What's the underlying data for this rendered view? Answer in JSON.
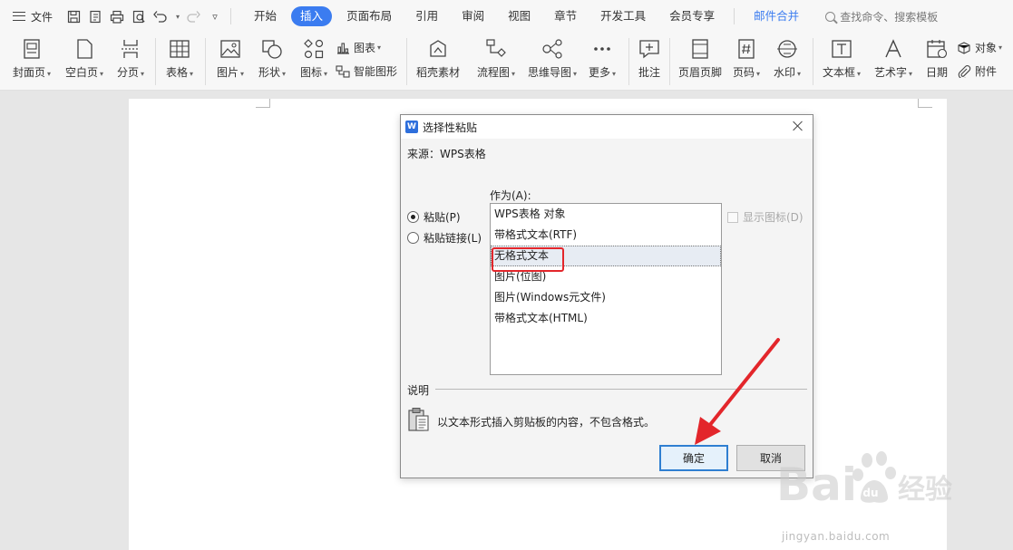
{
  "menubar": {
    "file_label": "文件",
    "tabs": [
      "开始",
      "插入",
      "页面布局",
      "引用",
      "审阅",
      "视图",
      "章节",
      "开发工具",
      "会员专享"
    ],
    "active_tab": "插入",
    "accent_tab": "邮件合并",
    "search_label": "查找命令、搜索模板"
  },
  "ribbon": {
    "cover_page": "封面页",
    "blank_page": "空白页",
    "page_break": "分页",
    "table": "表格",
    "picture": "图片",
    "shape": "形状",
    "icon": "图标",
    "chart": "图表",
    "smart_art": "智能图形",
    "shell_material": "稻壳素材",
    "flowchart": "流程图",
    "mindmap": "思维导图",
    "more": "更多",
    "comment": "批注",
    "header_footer": "页眉页脚",
    "page_number": "页码",
    "watermark": "水印",
    "textbox": "文本框",
    "wordart": "艺术字",
    "date": "日期",
    "object": "对象",
    "attachment": "附件"
  },
  "dialog": {
    "title": "选择性粘贴",
    "source": "来源：WPS表格",
    "as_label": "作为(A):",
    "radio_paste": "粘贴(P)",
    "radio_paste_link": "粘贴链接(L)",
    "show_icon": "显示图标(D)",
    "list_items": [
      "WPS表格 对象",
      "带格式文本(RTF)",
      "无格式文本",
      "图片(位图)",
      "图片(Windows元文件)",
      "带格式文本(HTML)"
    ],
    "selected_index": 2,
    "description_label": "说明",
    "description_text": "以文本形式插入剪贴板的内容，不包含格式。",
    "ok_label": "确定",
    "cancel_label": "取消"
  },
  "watermark": {
    "text": "jingyan.baidu.com"
  },
  "colors": {
    "accent": "#3b7cf0",
    "highlight_red": "#e3262b",
    "arrow_red": "#e3262b"
  }
}
